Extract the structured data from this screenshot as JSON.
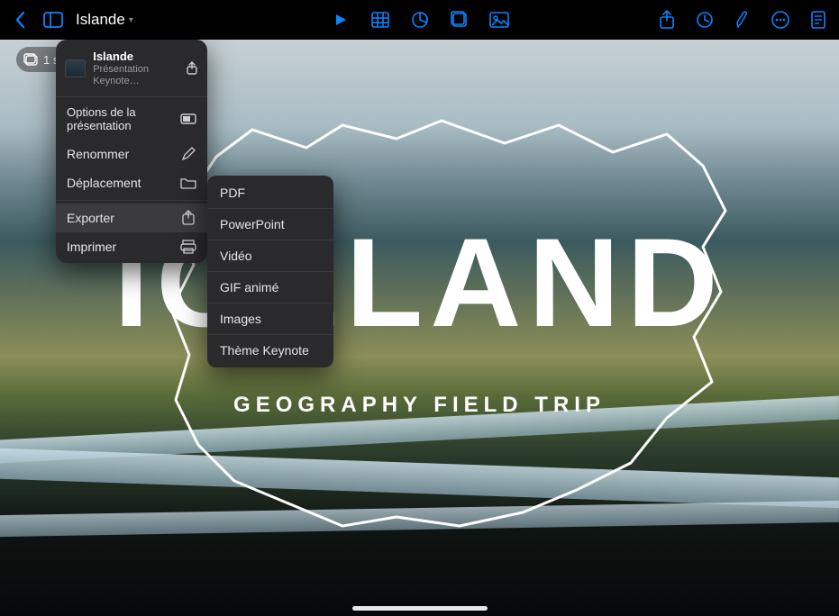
{
  "toolbar": {
    "doc_title": "Islande"
  },
  "slide_chip": {
    "count": "1 s"
  },
  "slide": {
    "title": "ICELAND",
    "subtitle": "GEOGRAPHY FIELD TRIP"
  },
  "popover": {
    "title": "Islande",
    "subtitle": "Présentation Keynote…",
    "options_label": "Options de la présentation",
    "rename_label": "Renommer",
    "move_label": "Déplacement",
    "export_label": "Exporter",
    "print_label": "Imprimer"
  },
  "export_menu": {
    "pdf": "PDF",
    "powerpoint": "PowerPoint",
    "video": "Vidéo",
    "gif": "GIF animé",
    "images": "Images",
    "theme": "Thème Keynote"
  }
}
